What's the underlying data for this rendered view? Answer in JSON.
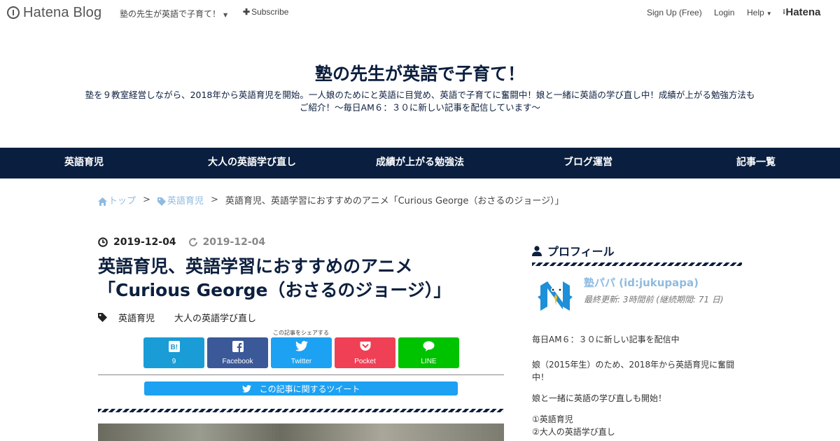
{
  "topbar": {
    "brand": "Hatena Blog",
    "blog_name": "塾の先生が英語で子育て！",
    "subscribe": "Subscribe",
    "signup": "Sign Up (Free)",
    "login": "Login",
    "help": "Help",
    "hatena": "Hatena"
  },
  "header": {
    "title": "塾の先生が英語で子育て！",
    "description_line1": "塾を９教室経営しながら、2018年から英語育児を開始。一人娘のためにと英語に目覚め、英語で子育てに奮闘中！娘と一緒に英語の学び直し中！成績が上がる勉強方法も",
    "description_line2": "ご紹介！～毎日AM６：３０に新しい記事を配信しています～"
  },
  "nav": {
    "items": [
      "英語育児",
      "大人の英語学び直し",
      "成績が上がる勉強法",
      "ブログ運営",
      "記事一覧"
    ]
  },
  "breadcrumb": {
    "home": "トップ",
    "category": "英語育児",
    "separator": ">",
    "current": "英語育児、英語学習におすすめのアニメ「Curious George（おさるのジョージ）」"
  },
  "article": {
    "published": "2019-12-04",
    "updated": "2019-12-04",
    "title_line1": "英語育児、英語学習におすすめのアニメ",
    "title_line2": "「Curious George（おさるのジョージ）」",
    "tags": [
      "英語育児",
      "大人の英語学び直し"
    ],
    "share_caption": "この記事をシェアする",
    "share_buttons": [
      {
        "label": "9",
        "icon": "hatena-bookmark-icon",
        "color": "#1a9cd7"
      },
      {
        "label": "Facebook",
        "icon": "facebook-icon",
        "color": "#3b5998"
      },
      {
        "label": "Twitter",
        "icon": "twitter-icon",
        "color": "#1da1f2"
      },
      {
        "label": "Pocket",
        "icon": "pocket-icon",
        "color": "#ef4056"
      },
      {
        "label": "LINE",
        "icon": "line-icon",
        "color": "#00c300"
      }
    ],
    "tweet_button": "この記事に関するツイート"
  },
  "sidebar": {
    "profile_heading": "プロフィール",
    "profile_name": "塾パパ (id:jukupapa)",
    "last_updated": "最終更新: 3時間前 (継続期間: 71 日)",
    "bio": [
      "毎日AM６：３０に新しい記事を配信中",
      "娘（2015年生）のため、2018年から英語育児に奮闘",
      "中！",
      "娘と一緒に英語の学び直しも開始！",
      "①英語育児",
      "②大人の英語学び直し"
    ]
  },
  "colors": {
    "navy": "#0a1f3f",
    "link": "#8fbbe0"
  }
}
